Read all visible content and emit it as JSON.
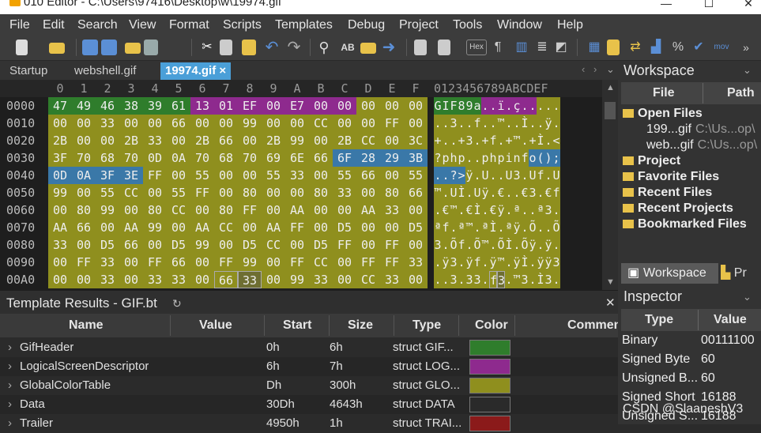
{
  "window": {
    "title": "010 Editor - C:\\Users\\97416\\Desktop\\w\\19974.gif"
  },
  "menu": [
    "File",
    "Edit",
    "Search",
    "View",
    "Format",
    "Scripts",
    "Templates",
    "Debug",
    "Project",
    "Tools",
    "Window",
    "Help"
  ],
  "toolbar": {
    "hex_label": "Hex",
    "mov_label": "mov"
  },
  "tabs": [
    {
      "label": "Startup"
    },
    {
      "label": "webshell.gif"
    },
    {
      "label": "19974.gif",
      "close": "×"
    }
  ],
  "hex": {
    "col_labels": [
      "0",
      "1",
      "2",
      "3",
      "4",
      "5",
      "6",
      "7",
      "8",
      "9",
      "A",
      "B",
      "C",
      "D",
      "E",
      "F"
    ],
    "char_header": "0123456789ABCDEF",
    "rows": [
      {
        "offset": "0000",
        "bytes": [
          "47",
          "49",
          "46",
          "38",
          "39",
          "61",
          "13",
          "01",
          "EF",
          "00",
          "E7",
          "00",
          "00",
          "00",
          "00",
          "00"
        ],
        "chars": "GIF89a..ï.ç....."
      },
      {
        "offset": "0010",
        "bytes": [
          "00",
          "00",
          "33",
          "00",
          "00",
          "66",
          "00",
          "00",
          "99",
          "00",
          "00",
          "CC",
          "00",
          "00",
          "FF",
          "00"
        ],
        "chars": "..3..f..™..Ì..ÿ."
      },
      {
        "offset": "0020",
        "bytes": [
          "2B",
          "00",
          "00",
          "2B",
          "33",
          "00",
          "2B",
          "66",
          "00",
          "2B",
          "99",
          "00",
          "2B",
          "CC",
          "00",
          "3C"
        ],
        "chars": "+..+3.+f.+™.+Ì.<"
      },
      {
        "offset": "0030",
        "bytes": [
          "3F",
          "70",
          "68",
          "70",
          "0D",
          "0A",
          "70",
          "68",
          "70",
          "69",
          "6E",
          "66",
          "6F",
          "28",
          "29",
          "3B"
        ],
        "chars": "?php..phpinfo();"
      },
      {
        "offset": "0040",
        "bytes": [
          "0D",
          "0A",
          "3F",
          "3E",
          "FF",
          "00",
          "55",
          "00",
          "00",
          "55",
          "33",
          "00",
          "55",
          "66",
          "00",
          "55"
        ],
        "chars": "..?>ÿ.U..U3.Uf.U"
      },
      {
        "offset": "0050",
        "bytes": [
          "99",
          "00",
          "55",
          "CC",
          "00",
          "55",
          "FF",
          "00",
          "80",
          "00",
          "00",
          "80",
          "33",
          "00",
          "80",
          "66"
        ],
        "chars": "™.UÌ.Uÿ.€..€3.€f"
      },
      {
        "offset": "0060",
        "bytes": [
          "00",
          "80",
          "99",
          "00",
          "80",
          "CC",
          "00",
          "80",
          "FF",
          "00",
          "AA",
          "00",
          "00",
          "AA",
          "33",
          "00"
        ],
        "chars": ".€™.€Ì.€ÿ.ª..ª3."
      },
      {
        "offset": "0070",
        "bytes": [
          "AA",
          "66",
          "00",
          "AA",
          "99",
          "00",
          "AA",
          "CC",
          "00",
          "AA",
          "FF",
          "00",
          "D5",
          "00",
          "00",
          "D5"
        ],
        "chars": "ªf.ª™.ªÌ.ªÿ.Õ..Õ"
      },
      {
        "offset": "0080",
        "bytes": [
          "33",
          "00",
          "D5",
          "66",
          "00",
          "D5",
          "99",
          "00",
          "D5",
          "CC",
          "00",
          "D5",
          "FF",
          "00",
          "FF",
          "00"
        ],
        "chars": "3.Õf.Õ™.ÕÌ.Õÿ.ÿ."
      },
      {
        "offset": "0090",
        "bytes": [
          "00",
          "FF",
          "33",
          "00",
          "FF",
          "66",
          "00",
          "FF",
          "99",
          "00",
          "FF",
          "CC",
          "00",
          "FF",
          "FF",
          "33"
        ],
        "chars": ".ÿ3.ÿf.ÿ™.ÿÌ.ÿÿ3"
      },
      {
        "offset": "00A0",
        "bytes": [
          "00",
          "00",
          "33",
          "00",
          "33",
          "33",
          "00",
          "66",
          "33",
          "00",
          "99",
          "33",
          "00",
          "CC",
          "33",
          "00"
        ],
        "chars": "..3.33.f3.™3.Ì3."
      }
    ]
  },
  "template": {
    "title": "Template Results - GIF.bt",
    "columns": [
      "Name",
      "Value",
      "Start",
      "Size",
      "Type",
      "Color",
      "Comment"
    ],
    "rows": [
      {
        "name": "GifHeader",
        "value": "",
        "start": "0h",
        "size": "6h",
        "type": "struct GIF...",
        "color": "#2f7d2c"
      },
      {
        "name": "LogicalScreenDescriptor",
        "value": "",
        "start": "6h",
        "size": "7h",
        "type": "struct LOG...",
        "color": "#8e2a8e"
      },
      {
        "name": "GlobalColorTable",
        "value": "",
        "start": "Dh",
        "size": "300h",
        "type": "struct GLO...",
        "color": "#8f8f1e"
      },
      {
        "name": "Data",
        "value": "",
        "start": "30Dh",
        "size": "4643h",
        "type": "struct DATA",
        "color": "#2a2a2a"
      },
      {
        "name": "Trailer",
        "value": "",
        "start": "4950h",
        "size": "1h",
        "type": "struct TRAI...",
        "color": "#8b1a1a"
      }
    ]
  },
  "colors": {
    "header": "#2f7d2c",
    "lsd": "#8e2a8e",
    "gct": "#8f8f1e",
    "data": "#3a78a8",
    "selected": "#8b1a1a",
    "bg": "#1e1e1e"
  },
  "workspace": {
    "title": "Workspace",
    "col_file": "File",
    "col_path": "Path",
    "items": [
      {
        "label": "Open Files",
        "bold": true,
        "level": 0
      },
      {
        "label": "199...gif",
        "path": "C:\\Us...op\\",
        "level": 1
      },
      {
        "label": "web...gif",
        "path": "C:\\Us...op\\",
        "level": 1
      },
      {
        "label": "Project",
        "bold": true,
        "level": 0
      },
      {
        "label": "Favorite Files",
        "bold": true,
        "level": 0
      },
      {
        "label": "Recent Files",
        "bold": true,
        "level": 0
      },
      {
        "label": "Recent Projects",
        "bold": true,
        "level": 0
      },
      {
        "label": "Bookmarked Files",
        "bold": true,
        "level": 0
      }
    ],
    "tab_label": "Workspace",
    "tab2_label": "Pr"
  },
  "inspector": {
    "title": "Inspector",
    "col_type": "Type",
    "col_value": "Value",
    "rows": [
      {
        "type": "Binary",
        "value": "00111100"
      },
      {
        "type": "Signed Byte",
        "value": "60"
      },
      {
        "type": "Unsigned B...",
        "value": "60"
      },
      {
        "type": "Signed Short",
        "value": "16188"
      },
      {
        "type": "Unsigned S...",
        "value": "16188"
      }
    ]
  },
  "watermark": "CSDN @SlaaneshV3"
}
